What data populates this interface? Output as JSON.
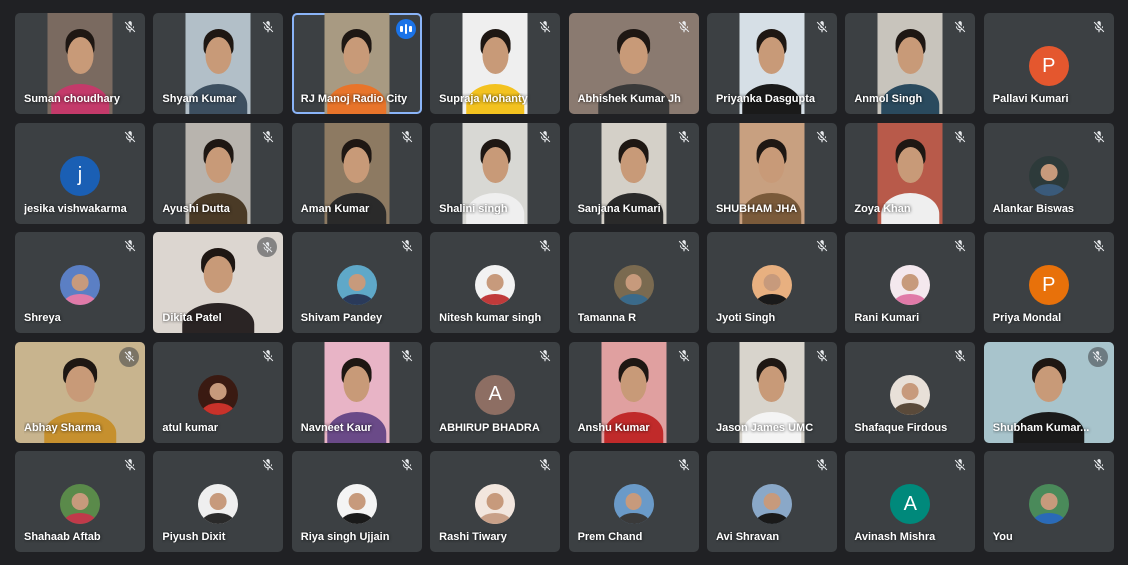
{
  "meeting": {
    "participants": [
      {
        "name": "Suman choudhary",
        "video": true,
        "bg": "#7a6a60",
        "top": "#c43a6a",
        "mic_muted": true
      },
      {
        "name": "Shyam Kumar",
        "video": true,
        "bg": "#b2bfc8",
        "top": "#3d4f60",
        "mic_muted": true
      },
      {
        "name": "RJ Manoj Radio City",
        "video": true,
        "bg": "#a89a82",
        "top": "#e8742a",
        "speaking": true,
        "active": true
      },
      {
        "name": "Supraja Mohanty",
        "video": true,
        "bg": "#efefef",
        "top": "#f3c21f",
        "mic_muted": true
      },
      {
        "name": "Abhishek Kumar Jh",
        "video": true,
        "full": true,
        "bg": "#8a7a70",
        "top": "#3a3a3a",
        "mic_muted": true
      },
      {
        "name": "Priyanka Dasgupta",
        "video": true,
        "bg": "#d6dfe6",
        "top": "#1a1a1a",
        "mic_muted": true
      },
      {
        "name": "Anmol Singh",
        "video": true,
        "bg": "#c8c4bc",
        "top": "#2a4a5e",
        "mic_muted": true
      },
      {
        "name": "Pallavi Kumari",
        "avatar_letter": "P",
        "avatar_color": "#e4572e",
        "mic_muted": true
      },
      {
        "name": "jesika vishwakarma",
        "avatar_letter": "j",
        "avatar_color": "#1a5fb4",
        "mic_muted": true
      },
      {
        "name": "Ayushi Dutta",
        "video": true,
        "bg": "#b8b4ae",
        "top": "#4a3a26",
        "mic_muted": true
      },
      {
        "name": "Aman Kumar",
        "video": true,
        "bg": "#8d7a62",
        "top": "#2a2a2a",
        "mic_muted": true
      },
      {
        "name": "Shalini singh",
        "video": true,
        "bg": "#d8d8d4",
        "top": "#efefef",
        "mic_muted": true
      },
      {
        "name": "Sanjana Kumari",
        "video": true,
        "bg": "#d4d0c8",
        "top": "#2a2a2a",
        "mic_muted": true
      },
      {
        "name": "SHUBHAM JHA",
        "video": true,
        "bg": "#c8a080",
        "top": "#7a5a3a",
        "mic_muted": true
      },
      {
        "name": "Zoya Khan",
        "video": true,
        "bg": "#b85a4a",
        "top": "#efefef",
        "mic_muted": true
      },
      {
        "name": "Alankar Biswas",
        "avatar_photo": true,
        "avatar_color": "#2d3a3a",
        "photo_top": "#3a5a7a",
        "mic_muted": true
      },
      {
        "name": "Shreya",
        "avatar_photo": true,
        "avatar_color": "#5b7fc4",
        "photo_top": "#e07aa8",
        "mic_muted": true
      },
      {
        "name": "Dikita Patel",
        "video": true,
        "full": true,
        "bg": "#dcd6d0",
        "top": "#2a2424",
        "mic_muted": true,
        "mic_bubble": true
      },
      {
        "name": "Shivam Pandey",
        "avatar_photo": true,
        "avatar_color": "#5fa8c8",
        "photo_top": "#2a3a5a",
        "mic_muted": true
      },
      {
        "name": "Nitesh kumar singh",
        "avatar_photo": true,
        "avatar_color": "#f2f2f2",
        "photo_top": "#c03a3a",
        "mic_muted": true
      },
      {
        "name": "Tamanna R",
        "avatar_photo": true,
        "avatar_color": "#7a6a50",
        "photo_top": "#3a6a8a",
        "mic_muted": true
      },
      {
        "name": "Jyoti Singh",
        "avatar_photo": true,
        "avatar_color": "#e8b080",
        "photo_top": "#1a1a1a",
        "mic_muted": true
      },
      {
        "name": "Rani Kumari",
        "avatar_photo": true,
        "avatar_color": "#f4e8ee",
        "photo_top": "#e07aa8",
        "mic_muted": true
      },
      {
        "name": "Priya Mondal",
        "avatar_letter": "P",
        "avatar_color": "#e8710a",
        "mic_muted": true
      },
      {
        "name": "Abhay Sharma",
        "video": true,
        "full": true,
        "bg": "#c8b48e",
        "top": "#c6902e",
        "mic_muted": true,
        "mic_bubble": true
      },
      {
        "name": "atul kumar",
        "avatar_photo": true,
        "avatar_color": "#3a1a12",
        "photo_top": "#c8322a",
        "mic_muted": true
      },
      {
        "name": "Navneet Kaur",
        "video": true,
        "bg": "#e8b4c6",
        "top": "#6a4a88",
        "mic_muted": true
      },
      {
        "name": "ABHIRUP BHADRA",
        "avatar_letter": "A",
        "avatar_color": "#8d6e63",
        "mic_muted": true
      },
      {
        "name": "Anshu Kumar",
        "video": true,
        "bg": "#e0a0a0",
        "top": "#c02a2a",
        "mic_muted": true
      },
      {
        "name": "Jason James UMC",
        "video": true,
        "bg": "#d8d4cc",
        "top": "#f4f4f4",
        "mic_muted": true
      },
      {
        "name": "Shafaque Firdous",
        "avatar_photo": true,
        "avatar_color": "#e8e0d8",
        "photo_top": "#5a4a3a",
        "mic_muted": true
      },
      {
        "name": "Shubham Kumar...",
        "video": true,
        "full": true,
        "bg": "#a8c4cc",
        "top": "#1a1a1a",
        "mic_muted": true,
        "mic_bubble": true
      },
      {
        "name": "Shahaab Aftab",
        "avatar_photo": true,
        "avatar_color": "#5a8a4a",
        "photo_top": "#c03a4a",
        "mic_muted": true
      },
      {
        "name": "Piyush Dixit",
        "avatar_photo": true,
        "avatar_color": "#efefef",
        "photo_top": "#2a2a2a",
        "mic_muted": true
      },
      {
        "name": "Riya singh Ujjain",
        "avatar_photo": true,
        "avatar_color": "#f4f4f4",
        "photo_top": "#1a1a1a",
        "mic_muted": true
      },
      {
        "name": "Rashi Tiwary",
        "avatar_photo": true,
        "avatar_color": "#f2e6de",
        "photo_top": "#c8a088",
        "mic_muted": true
      },
      {
        "name": "Prem Chand",
        "avatar_photo": true,
        "avatar_color": "#6a9ac8",
        "photo_top": "#3a3a3a",
        "mic_muted": true
      },
      {
        "name": "Avi Shravan",
        "avatar_photo": true,
        "avatar_color": "#8aa8c8",
        "photo_top": "#1a1a1a",
        "mic_muted": true
      },
      {
        "name": "Avinash Mishra",
        "avatar_letter": "A",
        "avatar_color": "#00897b",
        "mic_muted": true
      },
      {
        "name": "You",
        "avatar_photo": true,
        "avatar_color": "#4a8a5a",
        "photo_top": "#2a6ab8",
        "mic_muted": true
      }
    ]
  },
  "icons": {
    "mic_muted": "mic-off-icon",
    "speaking": "audio-level-icon"
  },
  "colors": {
    "background": "#202124",
    "tile": "#3c4043",
    "active_outline": "#8ab4f8",
    "speaking_badge": "#1a73e8"
  }
}
